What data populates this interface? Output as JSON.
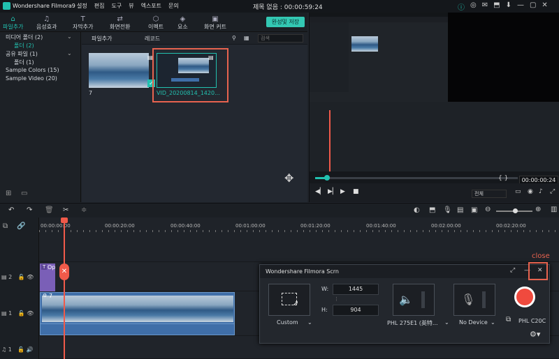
{
  "app": {
    "name": "Wondershare Filmora9",
    "center_title": "제목 없음 : 00:00:59:24"
  },
  "menu": [
    "설정",
    "편집",
    "도구",
    "뷰",
    "엑스포트",
    "문의"
  ],
  "window_icons": [
    "ⓘ",
    "◎",
    "✉",
    "⬒",
    "⬇",
    "—",
    "▢",
    "✕"
  ],
  "toolbar": {
    "tools": [
      {
        "label": "파일추가",
        "icon": "⌂"
      },
      {
        "label": "음성효과",
        "icon": "♫"
      },
      {
        "label": "자막추가",
        "icon": "T"
      },
      {
        "label": "화면전환",
        "icon": "⇄"
      },
      {
        "label": "이펙트",
        "icon": "⬡"
      },
      {
        "label": "요소",
        "icon": "◈"
      },
      {
        "label": "화면 커트",
        "icon": "▣"
      }
    ],
    "export": "완성및 저장"
  },
  "library": {
    "items": [
      {
        "label": "미디어 폴더 (2)"
      },
      {
        "label": "폴더 (2)"
      },
      {
        "label": "공유 파일 (1)"
      },
      {
        "label": "폴더 (1)"
      },
      {
        "label": "Sample Colors (15)"
      },
      {
        "label": "Sample Video (20)"
      }
    ]
  },
  "media": {
    "bar": {
      "add": "파일추가",
      "record": "레코드",
      "search_placeholder": "검색"
    },
    "items": [
      {
        "caption": "7"
      },
      {
        "caption": "VID_20200814_1420..."
      }
    ]
  },
  "preview": {
    "timecode": "00:00:00:24",
    "quality": "전체",
    "brackets": "{   }",
    "progress": 0.06
  },
  "timeline": {
    "ruler": [
      "00:00:00:00",
      "00:00:20:00",
      "00:00:40:00",
      "00:01:00:00",
      "00:01:20:00",
      "00:01:40:00",
      "00:02:00:00",
      "00:02:20:00"
    ],
    "tracks": [
      {
        "label": "2"
      },
      {
        "label": "1"
      },
      {
        "label": "1"
      }
    ],
    "title_clip": "Op",
    "video_clip": "7"
  },
  "recorder": {
    "title": "Wondershare Filmora Scrn",
    "mode": "Custom",
    "w_label": "W:",
    "w_value": "1445",
    "h_label": "H:",
    "h_value": "904",
    "screen": "PHL 275E1 (英特...",
    "mic": "No Device",
    "monitor": "PHL C20C"
  },
  "annotation": {
    "close_label": "close"
  },
  "colors": {
    "accent": "#22c1b0",
    "record": "#f04a3e",
    "annotation": "#e8634f"
  }
}
